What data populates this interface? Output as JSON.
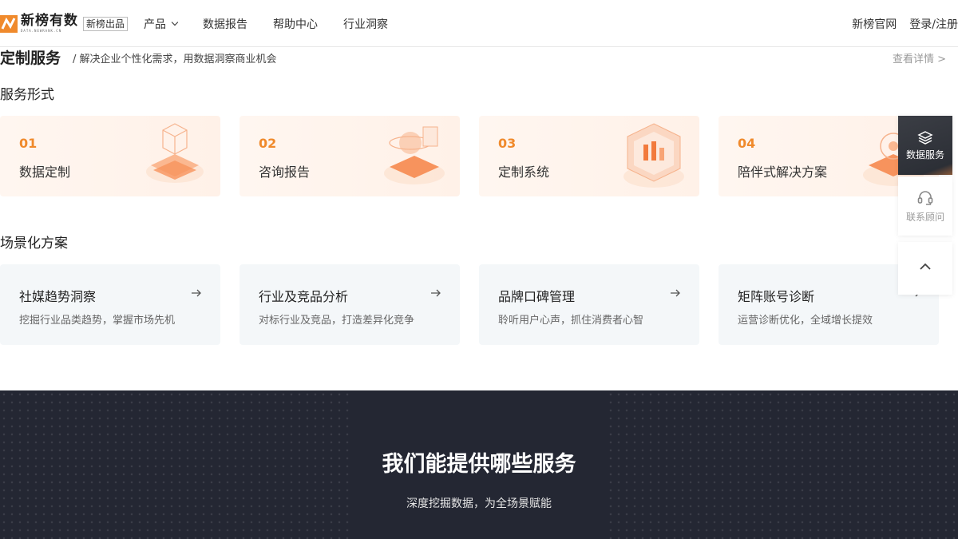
{
  "header": {
    "logo_text": "新榜有数",
    "logo_sub": "DATA.NEWRANK.CN",
    "logo_badge": "新榜出品",
    "nav": [
      {
        "label": "产品",
        "has_dropdown": true
      },
      {
        "label": "数据报告",
        "has_dropdown": false
      },
      {
        "label": "帮助中心",
        "has_dropdown": false
      },
      {
        "label": "行业洞察",
        "has_dropdown": false
      }
    ],
    "right": {
      "official_site": "新榜官网",
      "login": "登录/注册"
    }
  },
  "section": {
    "title": "定制服务",
    "subtitle": "/ 解决企业个性化需求，用数据洞察商业机会",
    "more": "查看详情 >"
  },
  "service_forms": {
    "heading": "服务形式",
    "items": [
      {
        "num": "01",
        "label": "数据定制",
        "icon": "cube-stack-icon"
      },
      {
        "num": "02",
        "label": "咨询报告",
        "icon": "report-globe-icon"
      },
      {
        "num": "03",
        "label": "定制系统",
        "icon": "system-chart-icon"
      },
      {
        "num": "04",
        "label": "陪伴式解决方案",
        "icon": "solution-icon"
      }
    ]
  },
  "scenarios": {
    "heading": "场景化方案",
    "items": [
      {
        "title": "社媒趋势洞察",
        "desc": "挖掘行业品类趋势，掌握市场先机"
      },
      {
        "title": "行业及竞品分析",
        "desc": "对标行业及竞品，打造差异化竞争"
      },
      {
        "title": "品牌口碑管理",
        "desc": "聆听用户心声，抓住消费者心智"
      },
      {
        "title": "矩阵账号诊断",
        "desc": "运营诊断优化，全域增长提效"
      }
    ]
  },
  "float_bar": {
    "data_service": "数据服务",
    "contact": "联系顾问"
  },
  "dark_section": {
    "title": "我们能提供哪些服务",
    "subtitle": "深度挖掘数据，为全场景赋能"
  },
  "colors": {
    "accent": "#f08a2c",
    "dark_bg": "#242733",
    "card_warm": "#fff3ec",
    "card_cool": "#f4f7f9"
  }
}
